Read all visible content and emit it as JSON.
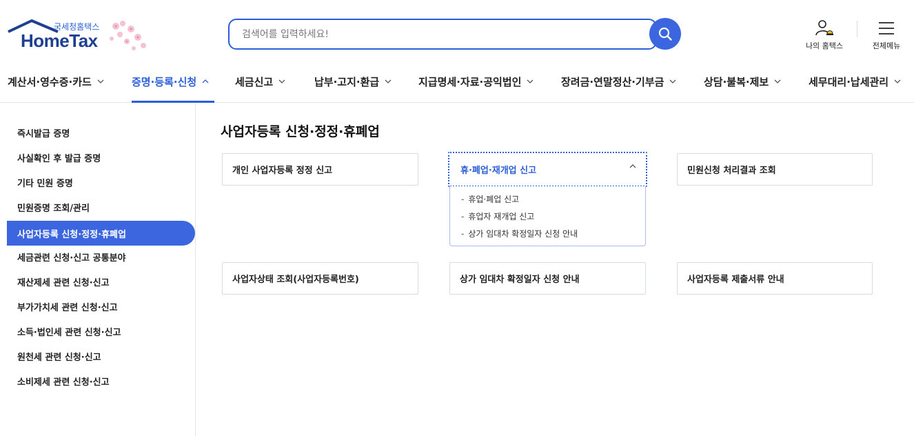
{
  "logo": {
    "small": "국세청홈택스",
    "main": "HomeTax"
  },
  "search": {
    "placeholder": "검색어를 입력하세요!"
  },
  "util": {
    "my_home": "나의 홈택스",
    "all_menu": "전체메뉴"
  },
  "gnb": [
    {
      "label": "계산서·영수증·카드",
      "active": false
    },
    {
      "label": "증명·등록·신청",
      "active": true
    },
    {
      "label": "세금신고",
      "active": false
    },
    {
      "label": "납부·고지·환급",
      "active": false
    },
    {
      "label": "지급명세·자료·공익법인",
      "active": false
    },
    {
      "label": "장려금·연말정산·기부금",
      "active": false
    },
    {
      "label": "상담·불복·제보",
      "active": false
    },
    {
      "label": "세무대리·납세관리",
      "active": false
    }
  ],
  "sidebar": {
    "items": [
      {
        "label": "즉시발급 증명"
      },
      {
        "label": "사실확인 후 발급 증명"
      },
      {
        "label": "기타 민원 증명"
      },
      {
        "label": "민원증명 조회/관리"
      },
      {
        "label": "사업자등록 신청·정정·휴폐업",
        "active": true
      },
      {
        "label": "세금관련 신청·신고 공통분야"
      },
      {
        "label": "재산제세 관련 신청·신고"
      },
      {
        "label": "부가가치세 관련 신청·신고"
      },
      {
        "label": "소득·법인세 관련 신청·신고"
      },
      {
        "label": "원천세 관련 신청·신고"
      },
      {
        "label": "소비제세 관련 신청·신고"
      }
    ]
  },
  "main": {
    "title": "사업자등록 신청·정정·휴폐업",
    "cards": [
      {
        "label": "개인 사업자등록 정정 신고"
      },
      {
        "label": "휴·폐업·재개업 신고",
        "expanded": true
      },
      {
        "label": "민원신청 처리결과 조회"
      },
      {
        "label": "사업자상태 조회(사업자등록번호)"
      },
      {
        "label": "상가 임대차 확정일자 신청 안내"
      },
      {
        "label": "사업자등록 제출서류 안내"
      }
    ],
    "submenu": [
      {
        "label": "휴업·폐업 신고"
      },
      {
        "label": "휴업자 재개업 신고"
      },
      {
        "label": "상가 임대차 확정일자 신청 안내"
      }
    ]
  },
  "colors": {
    "accent": "#3c66e0",
    "brand_dark": "#1f3f92",
    "border": "#d6dbe3"
  },
  "icons": {
    "search": "search-icon",
    "my_home": "user-bell-icon",
    "all_menu": "hamburger-icon",
    "chevron": "chevron-down-icon"
  }
}
